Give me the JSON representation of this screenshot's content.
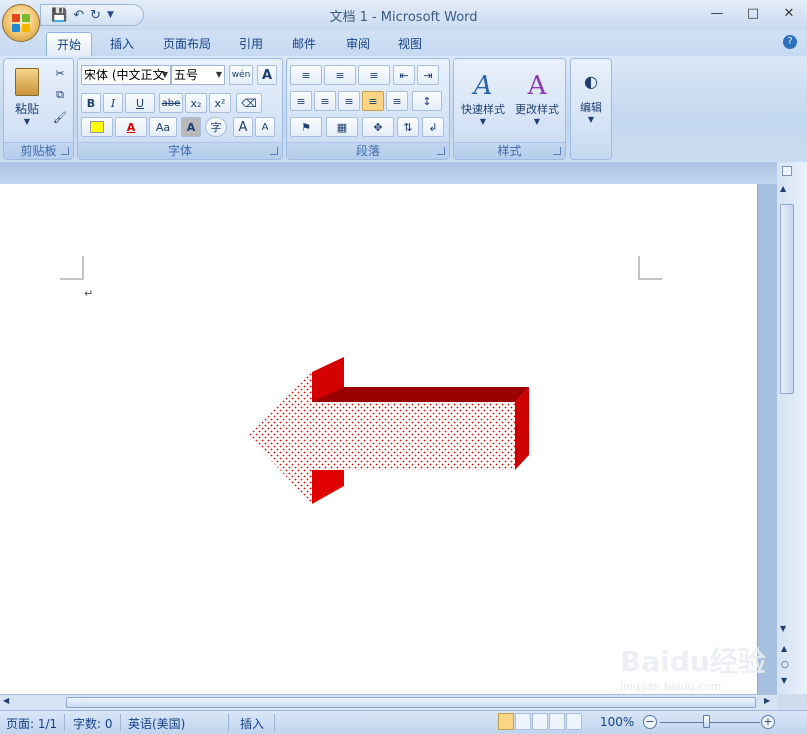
{
  "window": {
    "title": "文档 1 - Microsoft Word",
    "minimize_icon": "minimize-icon",
    "maximize_icon": "maximize-icon",
    "close_icon": "close-icon"
  },
  "quick_access": {
    "save_icon": "save-icon",
    "undo_icon": "undo-icon",
    "redo_icon": "redo-icon",
    "customize_icon": "customize-icon"
  },
  "tabs": [
    "开始",
    "插入",
    "页面布局",
    "引用",
    "邮件",
    "审阅",
    "视图"
  ],
  "active_tab": "开始",
  "ribbon": {
    "clipboard": {
      "label": "剪贴板",
      "paste_label": "粘贴"
    },
    "font": {
      "label": "字体",
      "font_name": "宋体 (中文正文",
      "font_size": "五号",
      "bold": "B",
      "italic": "I",
      "underline": "U",
      "strike": "abe",
      "subscript": "x₂",
      "superscript": "x²",
      "change_case": "Aa",
      "char_shading": "A",
      "enclose": "字",
      "grow": "A",
      "shrink": "A",
      "font_color": "A"
    },
    "paragraph": {
      "label": "段落"
    },
    "styles": {
      "label": "样式",
      "quick_styles": "快速样式",
      "change_styles": "更改样式"
    },
    "editing": {
      "label": "编辑"
    }
  },
  "document": {
    "paragraph_mark": "↵"
  },
  "shape": {
    "type": "3d-left-arrow",
    "fill_pattern": "red-dotted",
    "front_color": "#ff0000",
    "side_color": "#cc0000",
    "top_color": "#990000"
  },
  "status": {
    "page": "页面: 1/1",
    "words": "字数: 0",
    "language": "英语(美国)",
    "mode": "插入",
    "zoom": "100%"
  },
  "colors": {
    "ribbon_bg": "#c3d7ef",
    "text": "#15428b",
    "accent": "#fbd583"
  },
  "watermark": "Baidu经验",
  "watermark_sub": "jingyan.baidu.com"
}
